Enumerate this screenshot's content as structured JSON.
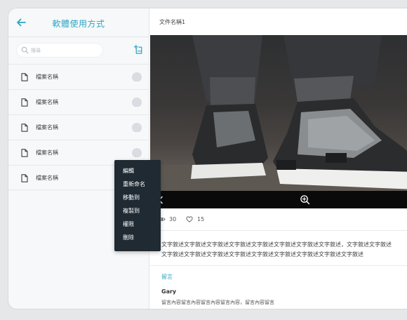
{
  "sidebar": {
    "title": "軟體使用方式",
    "search": {
      "placeholder": "搜尋"
    },
    "items": [
      {
        "label": "檔案名稱"
      },
      {
        "label": "檔案名稱"
      },
      {
        "label": "檔案名稱"
      },
      {
        "label": "檔案名稱"
      },
      {
        "label": "檔案名稱"
      }
    ]
  },
  "context_menu": {
    "items": [
      {
        "label": "編輯"
      },
      {
        "label": "重新命名"
      },
      {
        "label": "移動到"
      },
      {
        "label": "複製到"
      },
      {
        "label": "權限"
      },
      {
        "label": "刪除"
      }
    ]
  },
  "document": {
    "title": "文件名稱1",
    "image": {
      "subject": "sneakers-photo"
    },
    "stats": {
      "views": "30",
      "likes": "15"
    },
    "description": {
      "line1": "文字敘述文字敘述文字敘述文字敘述文字敘述文字敘述文字敘述文字敘述，文字敘述文字敘述",
      "line2": "文字敘述文字敘述文字敘述文字敘述文字敘述文字敘述文字敘述文字敘述文字敘述"
    },
    "comments": {
      "title": "留言",
      "items": [
        {
          "author": "Gary",
          "text": "留言內容留言內容留言內容留言內容，留言內容留言"
        }
      ]
    }
  },
  "colors": {
    "accent": "#2ba6c4",
    "menu_bg": "#1f2a33",
    "sidebar_bg": "#f7f8f9"
  },
  "icons": {
    "back": "arrow-left-icon",
    "search": "search-icon",
    "add": "add-document-icon",
    "file": "document-icon",
    "more": "more-icon",
    "prev": "chevron-left-icon",
    "zoom": "zoom-in-icon",
    "views": "eye-icon",
    "likes": "heart-icon"
  }
}
